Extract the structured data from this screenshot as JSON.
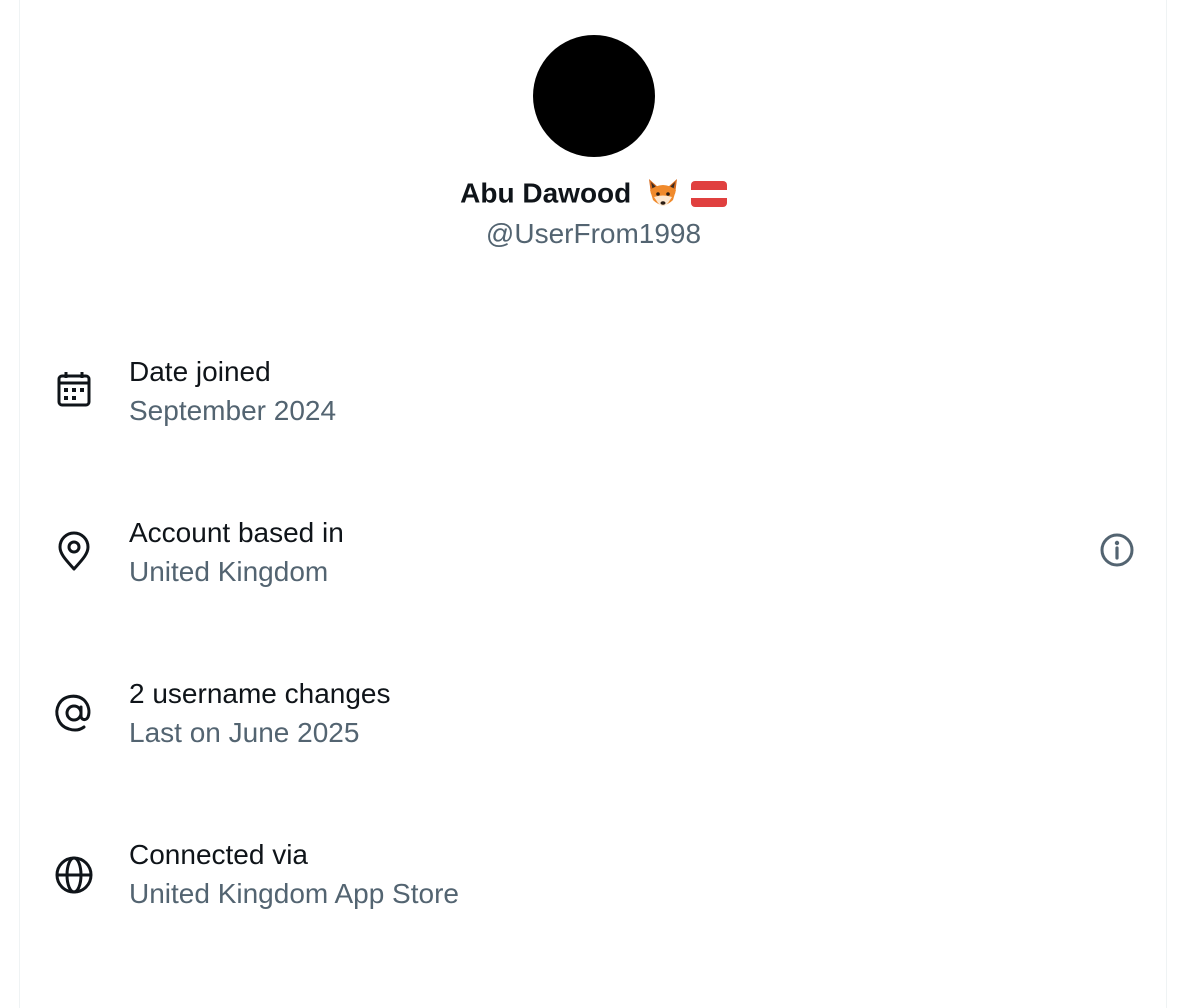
{
  "profile": {
    "display_name": "Abu Dawood",
    "name_emojis": [
      "fox-face-emoji",
      "flag-emoji"
    ],
    "handle": "@UserFrom1998"
  },
  "details": [
    {
      "icon": "calendar-icon",
      "label": "Date joined",
      "value": "September 2024"
    },
    {
      "icon": "location-pin-icon",
      "label": "Account based in",
      "value": "United Kingdom"
    },
    {
      "icon": "at-sign-icon",
      "label": "2 username changes",
      "value": "Last on June 2025"
    },
    {
      "icon": "globe-icon",
      "label": "Connected via",
      "value": "United Kingdom App Store"
    }
  ],
  "colors": {
    "primary_text": "#0f1419",
    "secondary_text": "#536471",
    "avatar": "#000000",
    "flag_red": "#e0403f"
  }
}
